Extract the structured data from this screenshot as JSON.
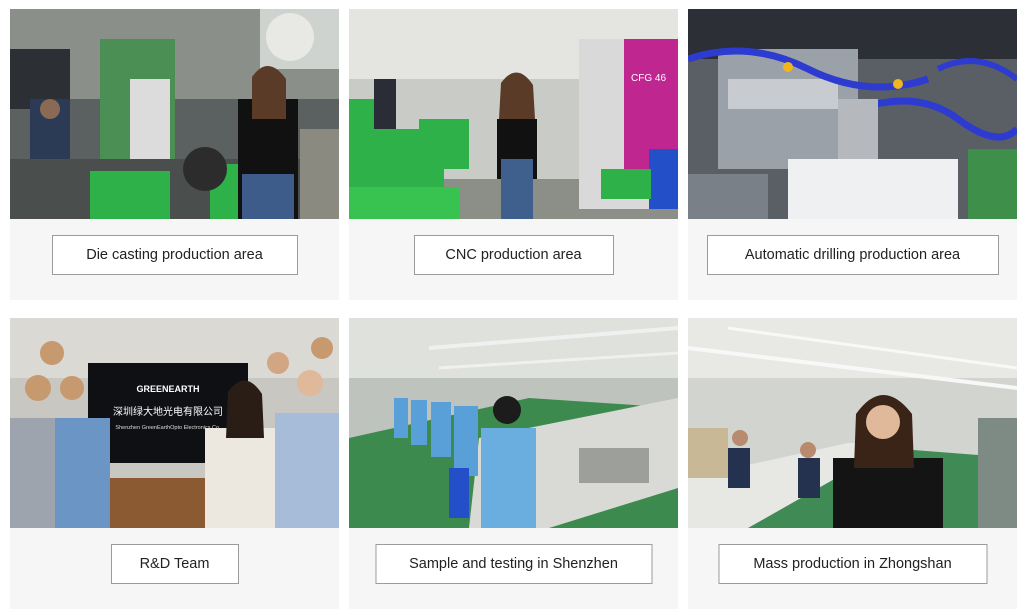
{
  "gallery": {
    "items": [
      {
        "label": "Die casting production area",
        "photo": "die-casting-workshop-photo"
      },
      {
        "label": "CNC production area",
        "photo": "cnc-workshop-photo",
        "machine_text": "CFG 46"
      },
      {
        "label": "Automatic drilling production area",
        "photo": "automatic-drilling-machine-photo"
      },
      {
        "label": "R&D Team",
        "photo": "rd-team-photo",
        "sign_brand": "GREENEARTH",
        "sign_cn": "深圳绿大地光电有限公司",
        "sign_en": "Shenzhen GreenEarthOpto Electronics Co."
      },
      {
        "label": "Sample and testing in Shenzhen",
        "photo": "sample-testing-line-photo"
      },
      {
        "label": "Mass production in Zhongshan",
        "photo": "mass-production-line-photo"
      }
    ]
  },
  "colors": {
    "card_background": "#f6f6f6",
    "label_border": "#9b9b9b",
    "crate_green": "#2fb14a",
    "machine_magenta": "#c0268f",
    "hose_blue": "#2d3bd0"
  }
}
